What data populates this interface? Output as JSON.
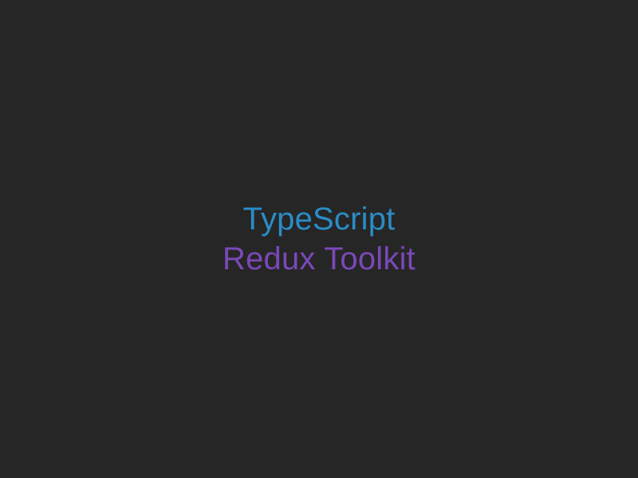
{
  "slide": {
    "line1": "TypeScript",
    "line2": "Redux Toolkit"
  }
}
